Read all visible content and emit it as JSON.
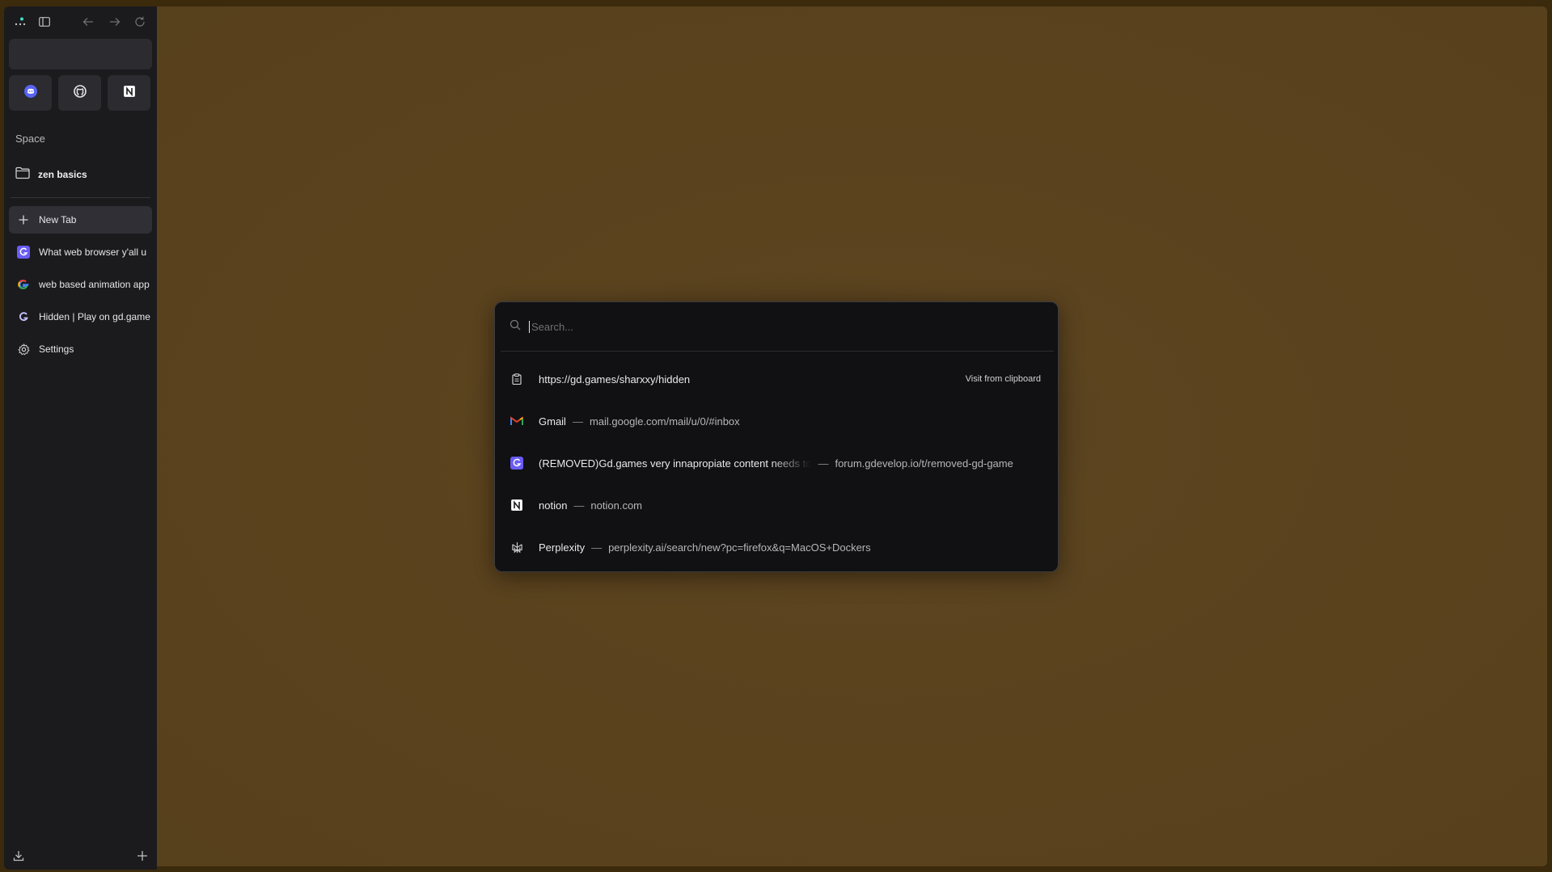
{
  "sidebar": {
    "toolbar": {
      "menu_icon": "zen-menu-icon",
      "sidebar_icon": "sidebar-toggle-icon",
      "back_icon": "back-arrow-icon",
      "forward_icon": "forward-arrow-icon",
      "reload_icon": "reload-icon"
    },
    "essentials": [
      {
        "name": "discord",
        "icon": "discord-icon"
      },
      {
        "name": "github",
        "icon": "github-icon"
      },
      {
        "name": "notion",
        "icon": "notion-icon"
      }
    ],
    "space_label": "Space",
    "folder": {
      "label": "zen basics",
      "icon": "folder-icon"
    },
    "tabs": [
      {
        "label": "New Tab",
        "icon": "plus-icon"
      },
      {
        "label": "What web browser y'all u",
        "icon": "gdevelop-icon"
      },
      {
        "label": "web based animation app",
        "icon": "google-icon"
      },
      {
        "label": "Hidden | Play on gd.game",
        "icon": "gdgames-icon"
      },
      {
        "label": "Settings",
        "icon": "gear-icon"
      }
    ],
    "bottom": {
      "download_icon": "download-icon",
      "add_icon": "plus-icon"
    }
  },
  "palette": {
    "search": {
      "placeholder": "Search...",
      "value": ""
    },
    "results": [
      {
        "title": "https://gd.games/sharxxy/hidden",
        "url": "",
        "action": "Visit from clipboard",
        "icon": "clipboard-icon"
      },
      {
        "title": "Gmail",
        "url": "mail.google.com/mail/u/0/#inbox",
        "action": "",
        "icon": "gmail-icon"
      },
      {
        "title": "(REMOVED)Gd.games very innapropiate content needs to",
        "url": "forum.gdevelop.io/t/removed-gd-game",
        "action": "",
        "icon": "gdevelop-icon"
      },
      {
        "title": "notion",
        "url": "notion.com",
        "action": "",
        "icon": "notion-icon"
      },
      {
        "title": "Perplexity",
        "url": "perplexity.ai/search/new?pc=firefox&q=MacOS+Dockers",
        "action": "",
        "icon": "perplexity-icon"
      }
    ],
    "separator": "—"
  },
  "colors": {
    "background": "#5a421d",
    "sidebar": "#1b1b1e",
    "palette": "#111113",
    "accent_discord": "#5865f2",
    "accent_gdevelop": "#6a5cf6"
  }
}
